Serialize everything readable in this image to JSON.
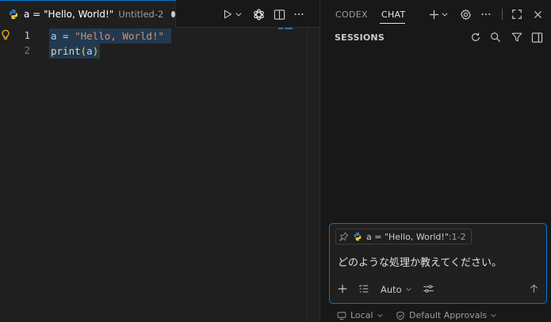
{
  "editor": {
    "tab": {
      "title": "a = \"Hello, World!\"",
      "description": "Untitled-2",
      "icon": "python-icon"
    },
    "actions": [
      "run-icon",
      "chevron-down-icon",
      "openai-icon",
      "split-editor-icon",
      "more-icon"
    ],
    "line_numbers": [
      "1",
      "2"
    ],
    "lines": [
      [
        {
          "t": "a",
          "c": "tok-var"
        },
        {
          "t": " = ",
          "c": "tok-op"
        },
        {
          "t": "\"Hello, World!\"",
          "c": "tok-str"
        }
      ],
      [
        {
          "t": "print",
          "c": "tok-fn"
        },
        {
          "t": "(",
          "c": "tok-paren"
        },
        {
          "t": "a",
          "c": "tok-var"
        },
        {
          "t": ")",
          "c": "tok-paren"
        }
      ]
    ]
  },
  "panel": {
    "tabs": {
      "codex": "CODEX",
      "chat": "CHAT"
    },
    "sessions_title": "SESSIONS",
    "context_chip": {
      "label": "a = \"Hello, World!\"",
      "range": ":1-2"
    },
    "chat_input_text": "どのような処理か教えてください。",
    "mode": "Auto",
    "footer": {
      "location": "Local",
      "approvals": "Default Approvals"
    }
  },
  "colors": {
    "accent": "#0078d4",
    "editor_bg": "#1f1f1f",
    "panel_bg": "#181818",
    "string": "#ce9178",
    "variable": "#9cdcfe",
    "function": "#dcdcaa"
  }
}
